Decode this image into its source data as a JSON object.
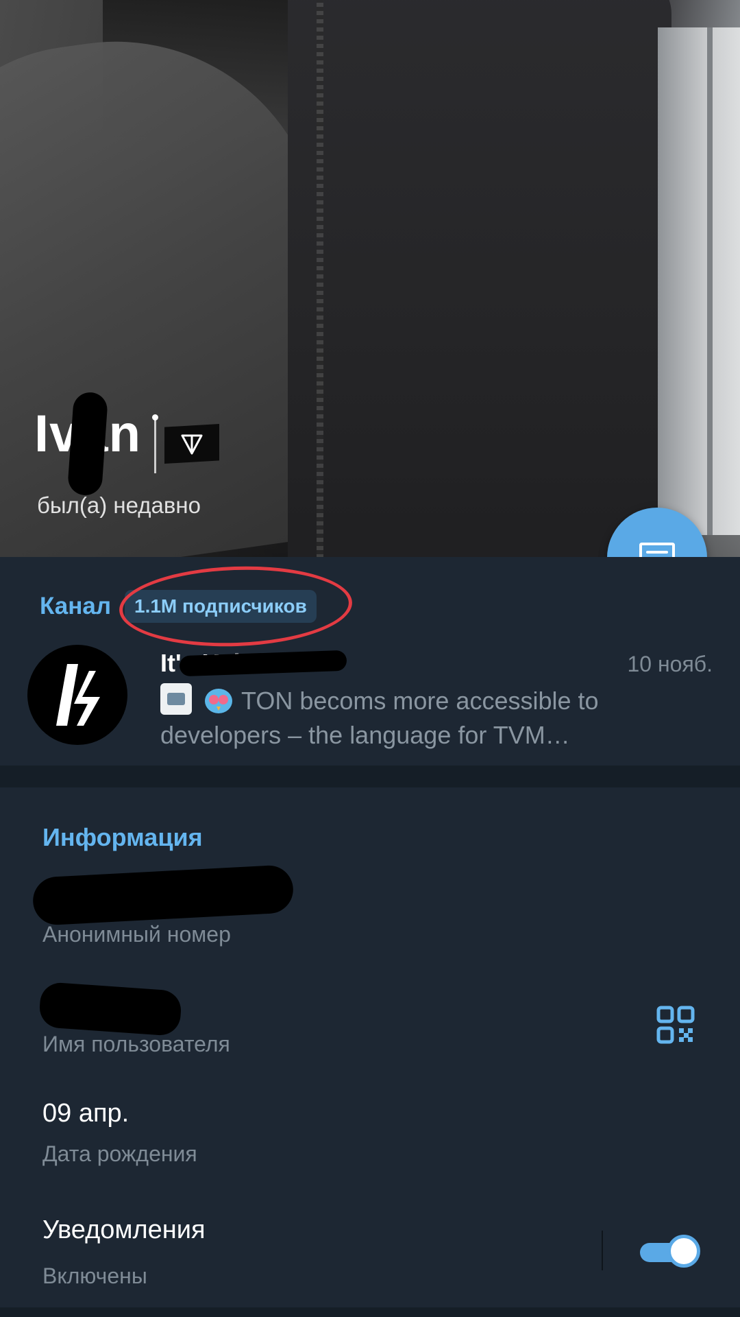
{
  "profile": {
    "name": "Ivan",
    "status": "был(а) недавно"
  },
  "channel": {
    "label": "Канал",
    "subscribers": "1.1M подписчиков",
    "title": "It's Kabanov",
    "date": "10 нояб.",
    "preview": "TON becoms more accessible to developers – the language for TVM…"
  },
  "info": {
    "heading": "Информация",
    "phone_label": "Анонимный номер",
    "username_label": "Имя пользователя",
    "birthday_value": "09 апр.",
    "birthday_label": "Дата рождения",
    "notifications_title": "Уведомления",
    "notifications_status": "Включены",
    "notifications_enabled": true
  },
  "colors": {
    "accent": "#64b5ef",
    "fab": "#5aa9e6",
    "background": "#1d2733",
    "annotation": "#e33b43"
  },
  "icons": {
    "message": "message-icon",
    "qr": "qr-code-icon",
    "premium_badge": "flag-badge-icon"
  }
}
